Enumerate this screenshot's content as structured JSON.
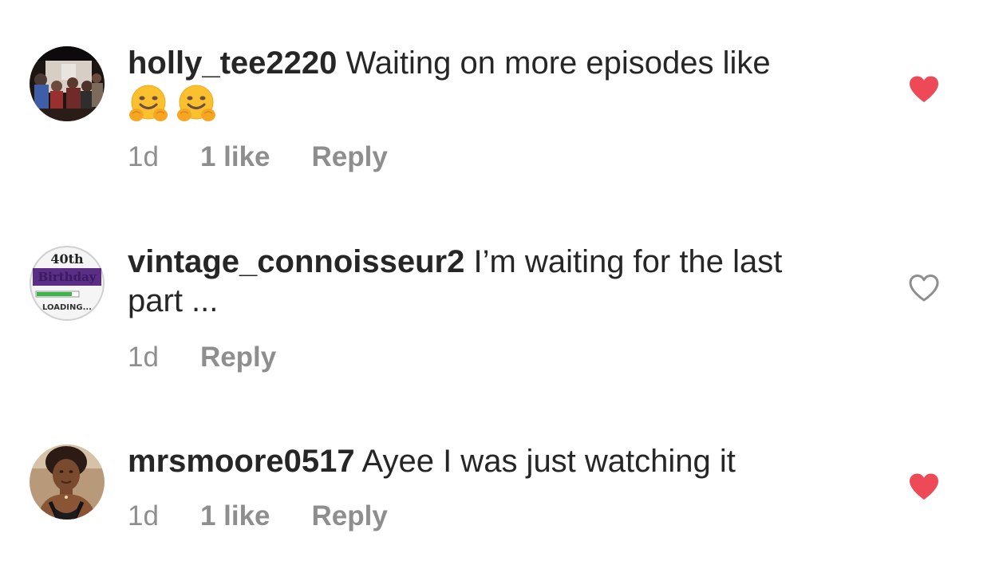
{
  "colors": {
    "text": "#262626",
    "meta": "#8e8e8e",
    "liked_heart": "#ed4956",
    "outline_heart": "#8e8e8e"
  },
  "comments": [
    {
      "username": "holly_tee2220",
      "text": "Waiting on more episodes like",
      "emoji": [
        "hugging-face-emoji",
        "hugging-face-emoji"
      ],
      "time": "1d",
      "likes": "1 like",
      "reply": "Reply",
      "liked": true
    },
    {
      "username": "vintage_connoisseur2",
      "text": "I’m waiting for the last part ...",
      "time": "1d",
      "reply": "Reply",
      "liked": false,
      "avatar_text": {
        "line1": "40th",
        "line2": "Birthday",
        "line3": "LOADING..."
      }
    },
    {
      "username": "mrsmoore0517",
      "text": "Ayee I was just watching it",
      "time": "1d",
      "likes": "1 like",
      "reply": "Reply",
      "liked": true
    }
  ]
}
